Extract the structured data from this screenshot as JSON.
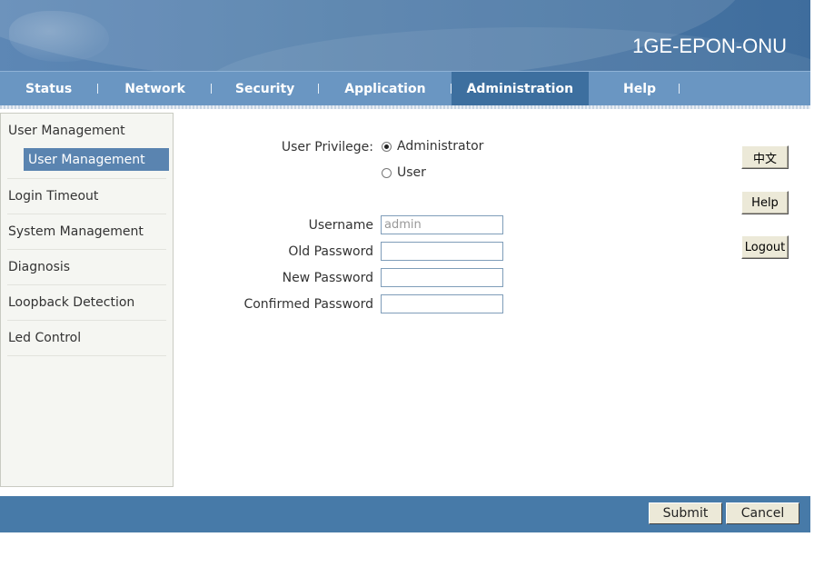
{
  "header": {
    "title": "1GE-EPON-ONU"
  },
  "nav": {
    "items": [
      {
        "label": "Status"
      },
      {
        "label": "Network"
      },
      {
        "label": "Security"
      },
      {
        "label": "Application"
      },
      {
        "label": "Administration",
        "active": true
      },
      {
        "label": "Help"
      }
    ]
  },
  "sidebar": {
    "user_management": "User Management",
    "user_management_sub": "User Management",
    "login_timeout": "Login Timeout",
    "system_management": "System Management",
    "diagnosis": "Diagnosis",
    "loopback_detection": "Loopback Detection",
    "led_control": "Led Control"
  },
  "form": {
    "privilege_label": "User Privilege:",
    "privilege_admin": "Administrator",
    "privilege_user": "User",
    "privilege_selected": "Administrator",
    "username_label": "Username",
    "username_value": "admin",
    "old_password_label": "Old Password",
    "new_password_label": "New Password",
    "confirmed_password_label": "Confirmed Password"
  },
  "side_buttons": {
    "language": "中文",
    "help": "Help",
    "logout": "Logout"
  },
  "footer": {
    "submit": "Submit",
    "cancel": "Cancel"
  },
  "colors": {
    "banner": "#4e7ba8",
    "nav": "#6a96c2",
    "nav_active": "#3d6f9f",
    "sidebar_selected": "#5a84b0",
    "footer": "#477aa8"
  }
}
